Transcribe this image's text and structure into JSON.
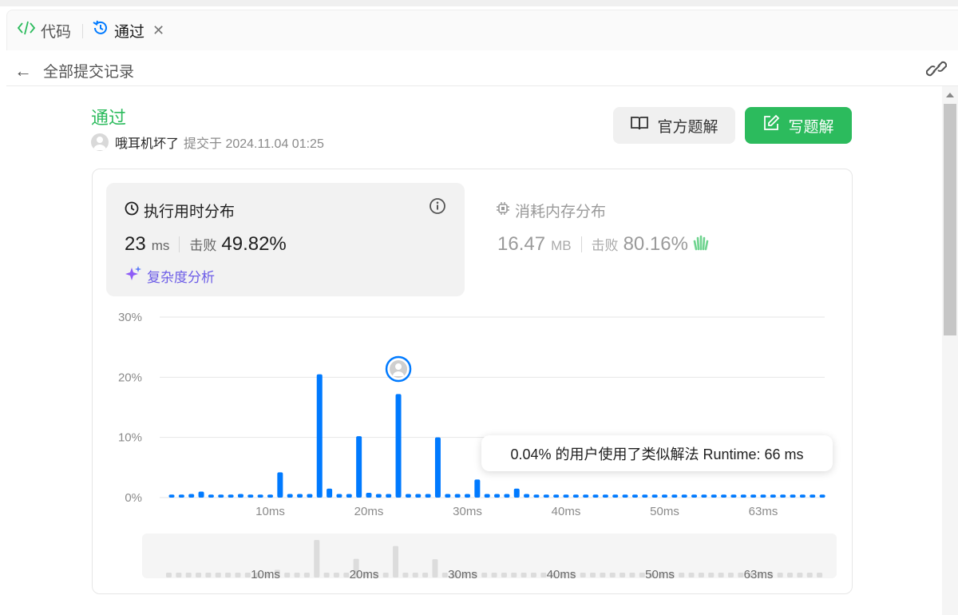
{
  "tabs": {
    "code_label": "代码",
    "pass_label": "通过"
  },
  "subbar": {
    "back_label": "全部提交记录"
  },
  "submission": {
    "status": "通过",
    "user": "哦耳机坏了",
    "submitted_at": "提交于 2024.11.04 01:25"
  },
  "actions": {
    "official_solution": "官方题解",
    "write_solution": "写题解"
  },
  "runtime": {
    "title": "执行用时分布",
    "value": "23",
    "unit": "ms",
    "beats_label": "击败",
    "beats_value": "49.82%",
    "complexity_label": "复杂度分析"
  },
  "memory": {
    "title": "消耗内存分布",
    "value": "16.47",
    "unit": "MB",
    "beats_label": "击败",
    "beats_value": "80.16%"
  },
  "tooltip": {
    "text": "0.04% 的用户使用了类似解法 Runtime: 66 ms"
  },
  "colors": {
    "accent_green": "#2cbb5d",
    "bar_blue": "#007aff",
    "preview_gray": "#dcdcdc",
    "purple": "#6c5ce7"
  },
  "chart_data": {
    "type": "bar",
    "y_ticks": [
      "30%",
      "20%",
      "10%",
      "0%"
    ],
    "ylim": [
      0,
      30
    ],
    "x_tick_labels": [
      "10ms",
      "20ms",
      "30ms",
      "40ms",
      "50ms",
      "63ms"
    ],
    "x_tick_bins": [
      10,
      20,
      30,
      40,
      50,
      60
    ],
    "user_bin": 23,
    "values": [
      0.5,
      0.5,
      0.6,
      1.0,
      0.5,
      0.5,
      0.5,
      0.6,
      0.5,
      0.5,
      0.5,
      4.2,
      0.6,
      0.6,
      0.6,
      20.5,
      1.5,
      0.6,
      0.6,
      10.2,
      0.8,
      0.6,
      0.6,
      17.2,
      0.6,
      0.6,
      0.6,
      10.0,
      0.6,
      0.6,
      0.6,
      3.0,
      0.6,
      0.6,
      0.6,
      1.5,
      0.6,
      0.5,
      0.5,
      0.5,
      0.5,
      0.5,
      0.5,
      0.5,
      0.5,
      0.5,
      0.5,
      0.5,
      0.5,
      0.5,
      0.5,
      0.5,
      0.5,
      0.5,
      0.5,
      0.5,
      0.5,
      0.5,
      0.5,
      0.5,
      0.5,
      0.5,
      0.5,
      0.5,
      0.5,
      0.5,
      0.5
    ]
  }
}
